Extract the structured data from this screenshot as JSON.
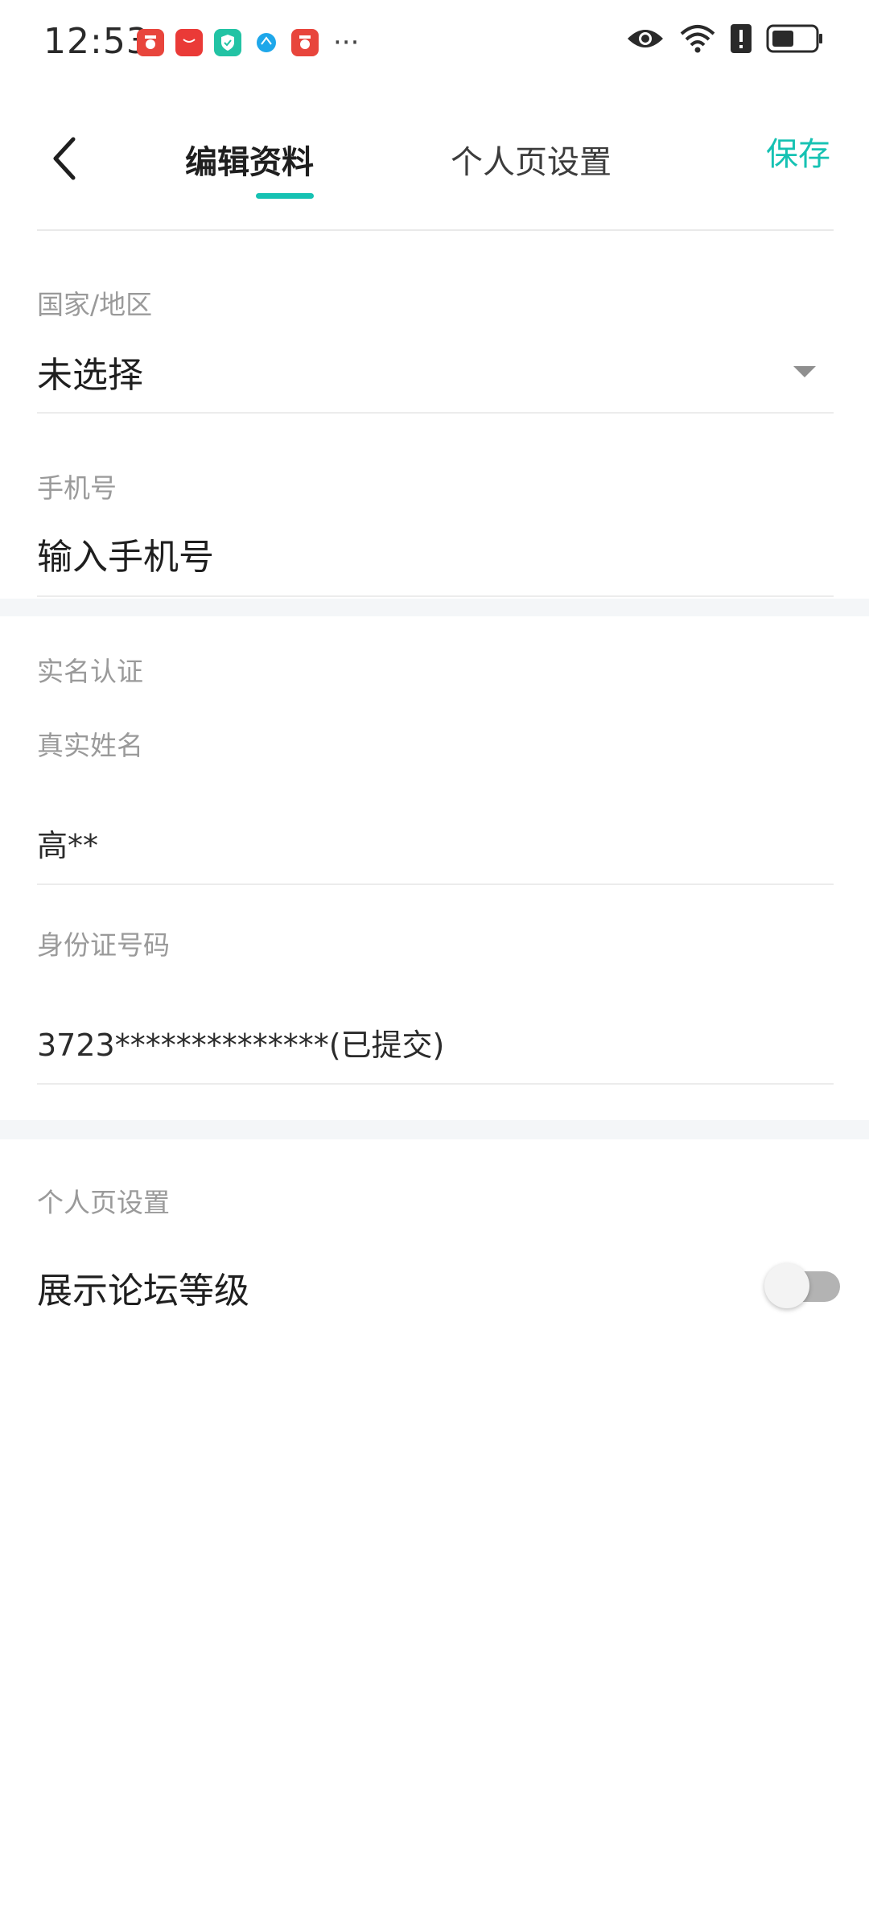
{
  "status_bar": {
    "time": "12:53",
    "more": "···",
    "app_icons": [
      "red-app-icon",
      "huawei-app-icon",
      "shield-app-icon",
      "blue-app-icon",
      "red-app-icon"
    ]
  },
  "header": {
    "tab_edit": "编辑资料",
    "tab_personal": "个人页设置",
    "save": "保存",
    "accent_color": "#16c2b3"
  },
  "region": {
    "label": "国家/地区",
    "value": "未选择"
  },
  "phone": {
    "label": "手机号",
    "placeholder": "输入手机号"
  },
  "realname": {
    "section_title": "实名认证",
    "name_label": "真实姓名",
    "name_value": "高**",
    "id_label": "身份证号码",
    "id_value": "3723**************(已提交)"
  },
  "personal_settings": {
    "section_title": "个人页设置",
    "show_level_label": "展示论坛等级",
    "show_level_enabled": false
  }
}
